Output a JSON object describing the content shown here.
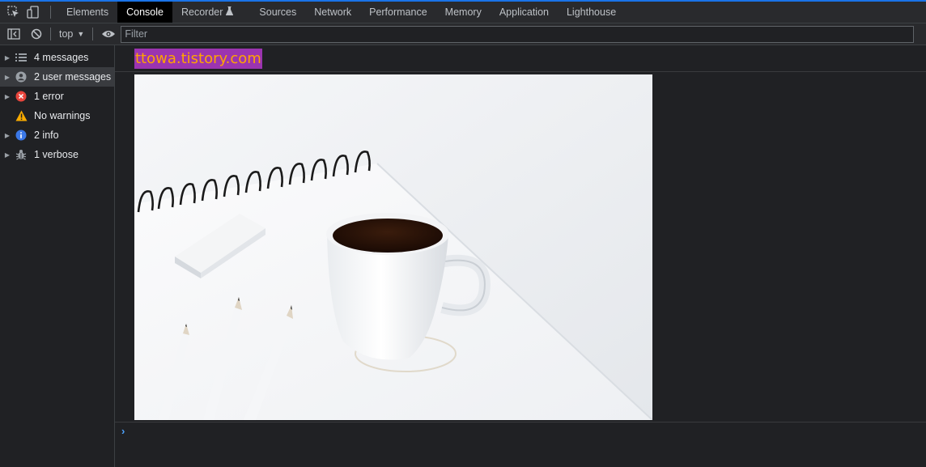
{
  "devtools": {
    "tabs": [
      {
        "label": "Elements"
      },
      {
        "label": "Console"
      },
      {
        "label": "Recorder"
      },
      {
        "label": "Sources"
      },
      {
        "label": "Network"
      },
      {
        "label": "Performance"
      },
      {
        "label": "Memory"
      },
      {
        "label": "Application"
      },
      {
        "label": "Lighthouse"
      }
    ],
    "active_tab": "Console"
  },
  "toolbar": {
    "context": "top",
    "filter_placeholder": "Filter"
  },
  "sidebar": {
    "items": [
      {
        "label": "4 messages",
        "icon": "list-icon",
        "expandable": true,
        "selected": false
      },
      {
        "label": "2 user messages",
        "icon": "user-icon",
        "expandable": true,
        "selected": true
      },
      {
        "label": "1 error",
        "icon": "error-icon",
        "expandable": true,
        "selected": false
      },
      {
        "label": "No warnings",
        "icon": "warning-icon",
        "expandable": false,
        "selected": false
      },
      {
        "label": "2 info",
        "icon": "info-icon",
        "expandable": true,
        "selected": false
      },
      {
        "label": "1 verbose",
        "icon": "bug-icon",
        "expandable": true,
        "selected": false
      }
    ]
  },
  "console": {
    "styled_log_text": "ttowa.tistory.com",
    "prompt_symbol": "›"
  },
  "colors": {
    "accent": "#1a73e8",
    "log_background": "#9b34b0",
    "log_text": "#ffa500",
    "error": "#e8453c",
    "warning": "#f9ab00",
    "info": "#3b78e7"
  }
}
